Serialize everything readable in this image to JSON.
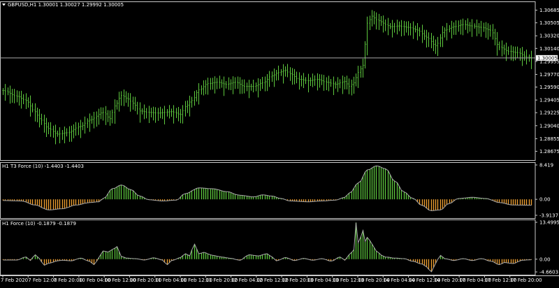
{
  "chart_data": [
    {
      "type": "candlestick",
      "title": "GBPUSD,H1  1.30001 1.30027 1.29992 1.30005",
      "symbol": "GBPUSD,H1",
      "ohlc_text": "1.30001 1.30027 1.29992 1.30005",
      "ylim": [
        1.2855,
        1.3081
      ],
      "y_ticks": [
        "1.30685",
        "1.30505",
        "1.30320",
        "1.30140",
        "1.29955",
        "1.29770",
        "1.29590",
        "1.29405",
        "1.29225",
        "1.29040",
        "1.28855",
        "1.28675"
      ],
      "current_price": "1.30005",
      "close_anchors": [
        [
          0,
          1.2954
        ],
        [
          6,
          1.2946
        ],
        [
          10,
          1.294
        ],
        [
          14,
          1.2924
        ],
        [
          16,
          1.2914
        ],
        [
          20,
          1.29
        ],
        [
          24,
          1.2892
        ],
        [
          28,
          1.2894
        ],
        [
          34,
          1.2903
        ],
        [
          38,
          1.2912
        ],
        [
          44,
          1.2923
        ],
        [
          47,
          1.2914
        ],
        [
          49,
          1.2932
        ],
        [
          52,
          1.2947
        ],
        [
          55,
          1.2942
        ],
        [
          57,
          1.2936
        ],
        [
          60,
          1.2925
        ],
        [
          64,
          1.2923
        ],
        [
          68,
          1.2922
        ],
        [
          74,
          1.2924
        ],
        [
          78,
          1.292
        ],
        [
          80,
          1.2931
        ],
        [
          83,
          1.294
        ],
        [
          86,
          1.2955
        ],
        [
          90,
          1.2964
        ],
        [
          94,
          1.2966
        ],
        [
          98,
          1.2963
        ],
        [
          102,
          1.2966
        ],
        [
          106,
          1.296
        ],
        [
          110,
          1.296
        ],
        [
          114,
          1.2965
        ],
        [
          118,
          1.2975
        ],
        [
          121,
          1.298
        ],
        [
          124,
          1.2983
        ],
        [
          126,
          1.2978
        ],
        [
          130,
          1.297
        ],
        [
          134,
          1.2968
        ],
        [
          138,
          1.297
        ],
        [
          142,
          1.2966
        ],
        [
          146,
          1.2963
        ],
        [
          150,
          1.2967
        ],
        [
          152,
          1.296
        ],
        [
          154,
          1.2965
        ],
        [
          156,
          1.298
        ],
        [
          158,
          1.299
        ],
        [
          160,
          1.305
        ],
        [
          162,
          1.306
        ],
        [
          164,
          1.3055
        ],
        [
          166,
          1.3052
        ],
        [
          168,
          1.3048
        ],
        [
          170,
          1.3045
        ],
        [
          174,
          1.3046
        ],
        [
          178,
          1.3044
        ],
        [
          182,
          1.304
        ],
        [
          186,
          1.303
        ],
        [
          190,
          1.3018
        ],
        [
          194,
          1.304
        ],
        [
          198,
          1.3045
        ],
        [
          202,
          1.3048
        ],
        [
          206,
          1.3046
        ],
        [
          210,
          1.3044
        ],
        [
          214,
          1.304
        ],
        [
          218,
          1.3016
        ],
        [
          222,
          1.301
        ],
        [
          226,
          1.3008
        ],
        [
          230,
          1.3002
        ],
        [
          232,
          1.30005
        ]
      ]
    },
    {
      "type": "histogram",
      "title": "H1 T3 Force (10) -1.4403 -1.4403",
      "y_ticks": [
        "8.419",
        "0.00",
        "-3.9137"
      ],
      "ylim": [
        -3.9137,
        8.419
      ],
      "series": [
        {
          "name": "positive",
          "color": "#5ec93e"
        },
        {
          "name": "negative",
          "color": "#f0a030"
        }
      ],
      "anchors": [
        [
          0,
          -0.3
        ],
        [
          8,
          -0.4
        ],
        [
          14,
          -1.4
        ],
        [
          20,
          -2.6
        ],
        [
          26,
          -2.3
        ],
        [
          32,
          -1.4
        ],
        [
          38,
          -0.8
        ],
        [
          42,
          -0.6
        ],
        [
          44,
          0.2
        ],
        [
          48,
          2.6
        ],
        [
          52,
          3.5
        ],
        [
          56,
          2.4
        ],
        [
          60,
          0.8
        ],
        [
          64,
          -0.1
        ],
        [
          70,
          -0.4
        ],
        [
          76,
          -0.2
        ],
        [
          80,
          1.4
        ],
        [
          86,
          2.8
        ],
        [
          92,
          2.6
        ],
        [
          98,
          1.9
        ],
        [
          104,
          1.0
        ],
        [
          110,
          0.6
        ],
        [
          114,
          1.1
        ],
        [
          118,
          0.8
        ],
        [
          122,
          0.2
        ],
        [
          126,
          -0.4
        ],
        [
          134,
          -0.6
        ],
        [
          140,
          -0.4
        ],
        [
          146,
          -0.2
        ],
        [
          150,
          0.5
        ],
        [
          152,
          1.5
        ],
        [
          156,
          4.0
        ],
        [
          160,
          7.2
        ],
        [
          164,
          8.2
        ],
        [
          168,
          7.5
        ],
        [
          172,
          4.5
        ],
        [
          176,
          1.8
        ],
        [
          180,
          0.2
        ],
        [
          184,
          -1.5
        ],
        [
          188,
          -2.8
        ],
        [
          192,
          -2.6
        ],
        [
          196,
          -1.0
        ],
        [
          200,
          0.2
        ],
        [
          206,
          0.5
        ],
        [
          212,
          0.2
        ],
        [
          218,
          -0.8
        ],
        [
          224,
          -1.4
        ],
        [
          232,
          -1.44
        ]
      ]
    },
    {
      "type": "histogram",
      "title": "H1 Force (10) -0.1879 -0.1879",
      "y_ticks": [
        "13.4995",
        "0.00",
        "-4.6603"
      ],
      "ylim": [
        -4.6603,
        13.4995
      ],
      "series": [
        {
          "name": "positive",
          "color": "#5ec93e"
        },
        {
          "name": "negative",
          "color": "#f0a030"
        }
      ],
      "anchors": [
        [
          0,
          -0.3
        ],
        [
          6,
          -0.3
        ],
        [
          10,
          0.8
        ],
        [
          12,
          -0.5
        ],
        [
          14,
          1.6
        ],
        [
          16,
          0.2
        ],
        [
          18,
          -2.2
        ],
        [
          20,
          -1.5
        ],
        [
          24,
          -0.6
        ],
        [
          26,
          -0.4
        ],
        [
          30,
          -0.6
        ],
        [
          34,
          0.4
        ],
        [
          38,
          -0.8
        ],
        [
          40,
          -2.0
        ],
        [
          42,
          0.6
        ],
        [
          44,
          3.0
        ],
        [
          46,
          2.6
        ],
        [
          48,
          3.5
        ],
        [
          50,
          4.6
        ],
        [
          52,
          1.0
        ],
        [
          54,
          0.4
        ],
        [
          58,
          0.2
        ],
        [
          62,
          -0.3
        ],
        [
          66,
          0.5
        ],
        [
          70,
          -0.3
        ],
        [
          72,
          -2.0
        ],
        [
          74,
          -0.5
        ],
        [
          78,
          0.6
        ],
        [
          80,
          2.0
        ],
        [
          82,
          1.2
        ],
        [
          84,
          5.5
        ],
        [
          86,
          2.0
        ],
        [
          88,
          2.5
        ],
        [
          92,
          1.4
        ],
        [
          96,
          0.8
        ],
        [
          100,
          0.3
        ],
        [
          104,
          -0.4
        ],
        [
          108,
          1.6
        ],
        [
          112,
          1.2
        ],
        [
          116,
          2.0
        ],
        [
          118,
          0.8
        ],
        [
          120,
          -0.6
        ],
        [
          124,
          0.6
        ],
        [
          128,
          -0.5
        ],
        [
          132,
          0.3
        ],
        [
          136,
          -0.4
        ],
        [
          140,
          0.2
        ],
        [
          144,
          -0.7
        ],
        [
          148,
          0.8
        ],
        [
          150,
          -0.4
        ],
        [
          152,
          1.6
        ],
        [
          154,
          3.5
        ],
        [
          155,
          13.4
        ],
        [
          156,
          6.0
        ],
        [
          158,
          10.5
        ],
        [
          159,
          6.5
        ],
        [
          160,
          8.0
        ],
        [
          162,
          5.5
        ],
        [
          164,
          3.0
        ],
        [
          166,
          1.5
        ],
        [
          168,
          0.8
        ],
        [
          172,
          0.4
        ],
        [
          176,
          0.2
        ],
        [
          180,
          -0.8
        ],
        [
          184,
          -1.8
        ],
        [
          186,
          -2.8
        ],
        [
          188,
          -4.6
        ],
        [
          190,
          -1.5
        ],
        [
          192,
          1.4
        ],
        [
          194,
          0.2
        ],
        [
          198,
          -0.5
        ],
        [
          202,
          0.2
        ],
        [
          206,
          -0.5
        ],
        [
          210,
          0.2
        ],
        [
          214,
          -0.7
        ],
        [
          218,
          -2.0
        ],
        [
          220,
          -1.2
        ],
        [
          224,
          -1.6
        ],
        [
          228,
          -0.4
        ],
        [
          232,
          -0.19
        ]
      ]
    }
  ],
  "x_ticks": [
    "7 Feb 2020",
    "7 Feb 12:00",
    "7 Feb 20:00",
    "10 Feb 04:00",
    "10 Feb 12:00",
    "10 Feb 20:00",
    "11 Feb 04:00",
    "11 Feb 12:00",
    "11 Feb 20:00",
    "12 Feb 04:00",
    "12 Feb 12:00",
    "12 Feb 20:00",
    "13 Feb 04:00",
    "13 Feb 12:00",
    "13 Feb 20:00",
    "14 Feb 04:00",
    "14 Feb 12:00",
    "14 Feb 20:00",
    "17 Feb 04:00",
    "17 Feb 12:00",
    "17 Feb 20:00"
  ],
  "colors": {
    "background": "#000000",
    "candle": "#5ec93e",
    "axis": "#c8c8c8",
    "text": "#ffffff",
    "positive": "#5ec93e",
    "negative": "#f0a030",
    "line": "#a8a8a8",
    "price_tag_bg": "#ffffff",
    "price_tag_fg": "#000000"
  },
  "icons": {
    "menu": "triangle-down-icon"
  }
}
